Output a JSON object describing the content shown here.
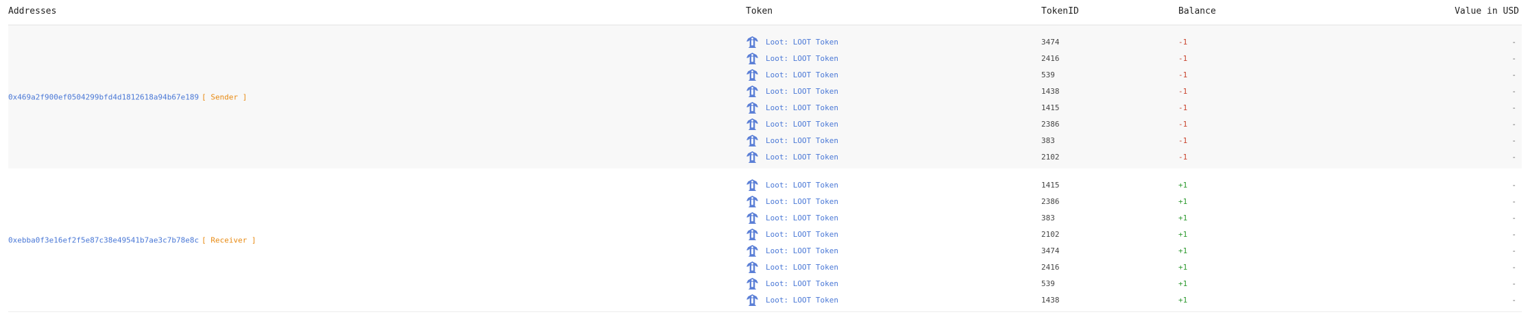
{
  "colors": {
    "link": "#4a78d6",
    "role": "#e88a12",
    "negative": "#c9442e",
    "positive": "#2e9a30",
    "icon": "#5b7fd6"
  },
  "header": {
    "addresses": "Addresses",
    "token": "Token",
    "token_id": "TokenID",
    "balance": "Balance",
    "value_usd": "Value in USD"
  },
  "groups": [
    {
      "address": "0x469a2f900ef0504299bfd4d1812618a94b67e189",
      "role": "[ Sender ]",
      "rows": [
        {
          "token_icon": "loot-token-icon",
          "token": "Loot: LOOT Token",
          "token_id": "3474",
          "balance": "-1",
          "value_usd": "-"
        },
        {
          "token_icon": "loot-token-icon",
          "token": "Loot: LOOT Token",
          "token_id": "2416",
          "balance": "-1",
          "value_usd": "-"
        },
        {
          "token_icon": "loot-token-icon",
          "token": "Loot: LOOT Token",
          "token_id": "539",
          "balance": "-1",
          "value_usd": "-"
        },
        {
          "token_icon": "loot-token-icon",
          "token": "Loot: LOOT Token",
          "token_id": "1438",
          "balance": "-1",
          "value_usd": "-"
        },
        {
          "token_icon": "loot-token-icon",
          "token": "Loot: LOOT Token",
          "token_id": "1415",
          "balance": "-1",
          "value_usd": "-"
        },
        {
          "token_icon": "loot-token-icon",
          "token": "Loot: LOOT Token",
          "token_id": "2386",
          "balance": "-1",
          "value_usd": "-"
        },
        {
          "token_icon": "loot-token-icon",
          "token": "Loot: LOOT Token",
          "token_id": "383",
          "balance": "-1",
          "value_usd": "-"
        },
        {
          "token_icon": "loot-token-icon",
          "token": "Loot: LOOT Token",
          "token_id": "2102",
          "balance": "-1",
          "value_usd": "-"
        }
      ]
    },
    {
      "address": "0xebba0f3e16ef2f5e87c38e49541b7ae3c7b78e8c",
      "role": "[ Receiver ]",
      "rows": [
        {
          "token_icon": "loot-token-icon",
          "token": "Loot: LOOT Token",
          "token_id": "1415",
          "balance": "+1",
          "value_usd": "-"
        },
        {
          "token_icon": "loot-token-icon",
          "token": "Loot: LOOT Token",
          "token_id": "2386",
          "balance": "+1",
          "value_usd": "-"
        },
        {
          "token_icon": "loot-token-icon",
          "token": "Loot: LOOT Token",
          "token_id": "383",
          "balance": "+1",
          "value_usd": "-"
        },
        {
          "token_icon": "loot-token-icon",
          "token": "Loot: LOOT Token",
          "token_id": "2102",
          "balance": "+1",
          "value_usd": "-"
        },
        {
          "token_icon": "loot-token-icon",
          "token": "Loot: LOOT Token",
          "token_id": "3474",
          "balance": "+1",
          "value_usd": "-"
        },
        {
          "token_icon": "loot-token-icon",
          "token": "Loot: LOOT Token",
          "token_id": "2416",
          "balance": "+1",
          "value_usd": "-"
        },
        {
          "token_icon": "loot-token-icon",
          "token": "Loot: LOOT Token",
          "token_id": "539",
          "balance": "+1",
          "value_usd": "-"
        },
        {
          "token_icon": "loot-token-icon",
          "token": "Loot: LOOT Token",
          "token_id": "1438",
          "balance": "+1",
          "value_usd": "-"
        }
      ]
    }
  ]
}
